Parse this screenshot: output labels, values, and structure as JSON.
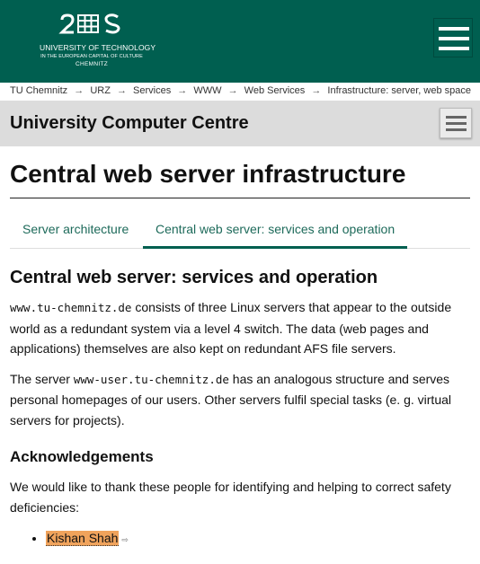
{
  "header": {
    "logo_mark": "2∃ξ",
    "logo_line1": "UNIVERSITY OF TECHNOLOGY",
    "logo_line2": "IN THE EUROPEAN CAPITAL OF CULTURE",
    "logo_line3": "CHEMNITZ",
    "colors": {
      "brand": "#005f50"
    }
  },
  "breadcrumb": [
    {
      "label": "TU Chemnitz"
    },
    {
      "label": "URZ"
    },
    {
      "label": "Services"
    },
    {
      "label": "WWW"
    },
    {
      "label": "Web Services"
    },
    {
      "label": "Infrastructure: server, web space"
    }
  ],
  "breadcrumb_separator": "→",
  "section": {
    "title": "University Computer Centre"
  },
  "page": {
    "title": "Central web server infrastructure"
  },
  "tabs": [
    {
      "label": "Server architecture",
      "active": false
    },
    {
      "label": "Central web server: services and operation",
      "active": true
    }
  ],
  "main": {
    "heading": "Central web server: services and operation",
    "p1_code": "www.tu-chemnitz.de",
    "p1_text": " consists of three Linux servers that appear to the outside world as a redundant system via a level 4 switch. The data (web pages and applications) themselves are also kept on redundant AFS file servers.",
    "p2_pre": "The server ",
    "p2_code": "www-user.tu-chemnitz.de",
    "p2_text": " has an analogous structure and serves personal homepages of our users. Other servers fulfil special tasks (e. g. virtual servers for projects).",
    "ack_heading": "Acknowledgements",
    "ack_text": "We would like to thank these people for identifying and helping to correct safety deficiencies:",
    "ack_people": [
      {
        "name": "Kishan Shah",
        "icon": "external-link-icon"
      }
    ]
  },
  "ext_icon_glyph": "⇨"
}
